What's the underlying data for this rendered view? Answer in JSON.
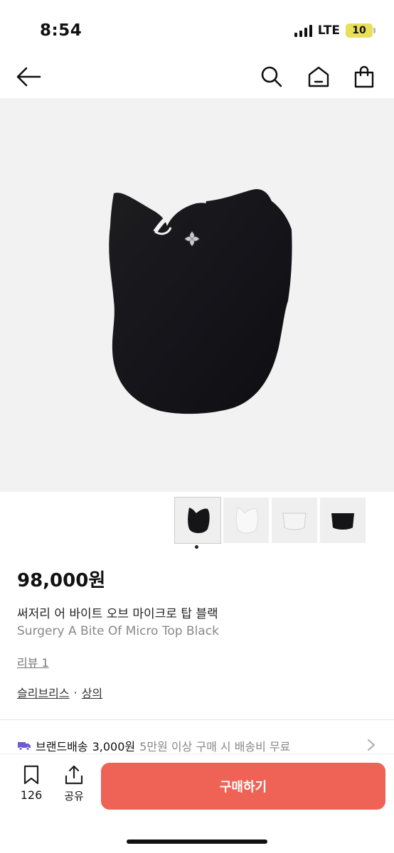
{
  "status": {
    "time": "8:54",
    "network": "LTE",
    "battery": "10"
  },
  "nav": {
    "back_icon": "arrow-left-icon",
    "search_icon": "search-icon",
    "home_icon": "home-icon",
    "bag_icon": "shopping-bag-icon"
  },
  "product": {
    "price": "98,000원",
    "name_ko": "써저리 어 바이트 오브 마이크로 탑 블랙",
    "name_en": "Surgery A Bite Of Micro Top Black",
    "review": "리뷰 1",
    "brand": "슬리브리스",
    "separator": "·",
    "category": "상의"
  },
  "gallery": {
    "count": 4,
    "active": 0
  },
  "shipping": {
    "label": "브랜드배송",
    "fee": "3,000원",
    "note": "5만원 이상 구매 시 배송비 무료"
  },
  "bottom": {
    "bookmark_count": "126",
    "share_label": "공유",
    "buy_label": "구매하기"
  },
  "colors": {
    "accent": "#ee6356",
    "battery": "#e9df59",
    "shipping_icon": "#6b5bd6"
  }
}
